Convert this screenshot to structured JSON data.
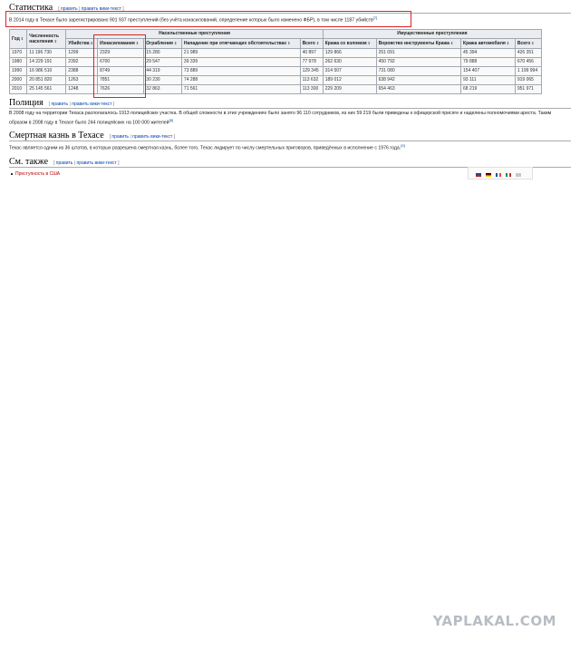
{
  "sections": {
    "statistics": {
      "title": "Статистика"
    },
    "police": {
      "title": "Полиция"
    },
    "death_penalty": {
      "title": "Смертная казнь в Техасе"
    },
    "see_also": {
      "title": "См. также"
    }
  },
  "edit_links": {
    "open": "[",
    "edit": "править",
    "sep": "|",
    "edit_source": "править вики-текст",
    "close": "]"
  },
  "statistics_text": "В 2014 году в Техасе было зарегистрировано 901 937 преступлений (без учёта изнасилований, определение которых было изменено ФБР), в том числе 1187 убийств",
  "statistics_ref": "[7]",
  "table": {
    "group_headers": {
      "violent": "Насильственные преступления",
      "property": "Имущественные преступления"
    },
    "headers": [
      "Год",
      "Численность населения",
      "Убийства",
      "Изнасилования",
      "Ограбления",
      "Нападение при отягчающих обстоятельствах",
      "Всего",
      "Кража со взломом",
      "Воровство инструменты Кража",
      "Кража автомобиля",
      "Всего"
    ],
    "rows": [
      [
        "1970",
        "11 196 730",
        "1299",
        "2329",
        "15 280",
        "21 989",
        "40 897",
        "129 866",
        "251 091",
        "45 394",
        "426 351"
      ],
      [
        "1980",
        "14 229 191",
        "2392",
        "6700",
        "29 547",
        "39 339",
        "77 978",
        "262 630",
        "450 792",
        "79 888",
        "670 456"
      ],
      [
        "1990",
        "16 986 510",
        "2388",
        "8749",
        "44 319",
        "73 889",
        "129 345",
        "314 507",
        "731 080",
        "154 407",
        "1 199 994"
      ],
      [
        "2000",
        "20 851 820",
        "1263",
        "7851",
        "30 230",
        "74 288",
        "113 632",
        "189 012",
        "638 942",
        "93 111",
        "919 065"
      ],
      [
        "2010",
        "25 145 561",
        "1248",
        "7626",
        "32 863",
        "71 561",
        "113 300",
        "229 209",
        "654 463",
        "68 219",
        "951 971"
      ]
    ]
  },
  "police_text": "В 2008 году на территории Техаса располагалось 1913 полицейских участка. В общей сложности в этих учреждениях было занято 96 110 сотрудников, из них 59 219 были приведены к офицерской присяге и наделены полномочиями ареста. Таким образом в 2008 году в Техасе было 244 полицейских на 100 000 жителей",
  "police_ref": "[8]",
  "death_penalty_text": "Техас является одним из 36 штатов, в которых разрешена смертная казнь, более того, Техас лидирует по числу смертельных приговоров, приведённых в исполнение с 1976 года.",
  "death_penalty_ref": "[9]",
  "see_also_items": [
    "Преступность в США"
  ],
  "watermark": "YAPLAKAL.COM",
  "colors": {
    "highlight": "#dd2222",
    "link": "#0645ad",
    "redlink": "#ba0000"
  }
}
